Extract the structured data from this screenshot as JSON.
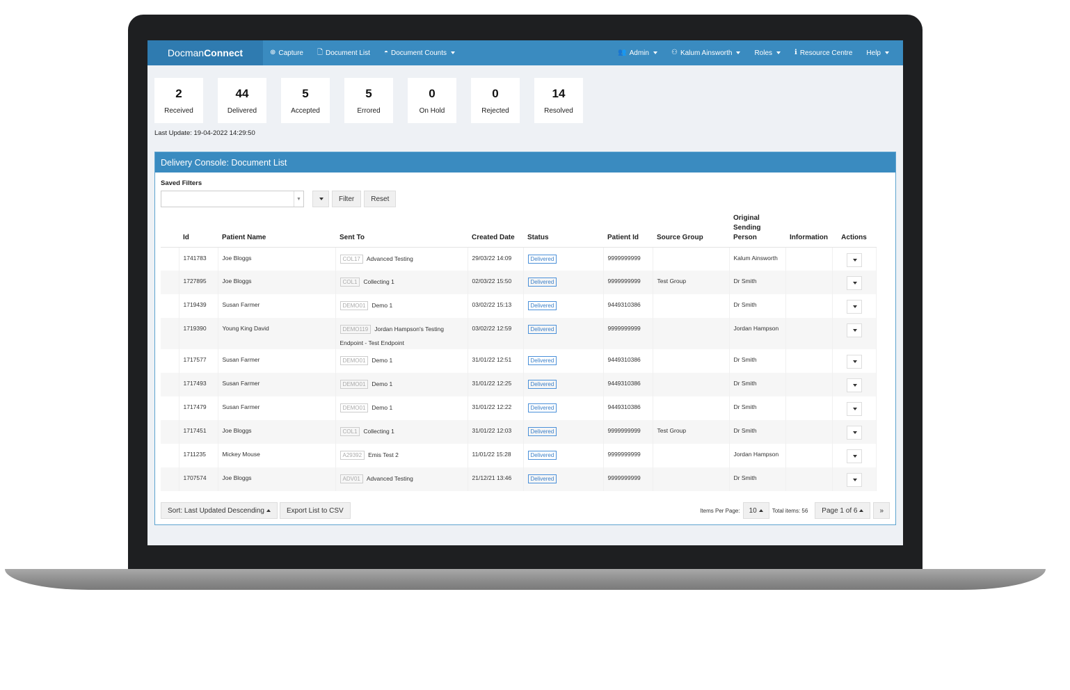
{
  "nav": {
    "brand_prefix": "Docman",
    "brand_suffix": "Connect",
    "capture": "Capture",
    "document_list": "Document List",
    "document_counts": "Document Counts",
    "admin": "Admin",
    "user": "Kalum Ainsworth",
    "roles": "Roles",
    "resource_centre": "Resource Centre",
    "help": "Help"
  },
  "stats": [
    {
      "value": "2",
      "label": "Received"
    },
    {
      "value": "44",
      "label": "Delivered"
    },
    {
      "value": "5",
      "label": "Accepted"
    },
    {
      "value": "5",
      "label": "Errored"
    },
    {
      "value": "0",
      "label": "On Hold"
    },
    {
      "value": "0",
      "label": "Rejected"
    },
    {
      "value": "14",
      "label": "Resolved"
    }
  ],
  "last_update": "Last Update: 19-04-2022 14:29:50",
  "panel": {
    "title": "Delivery Console: Document List",
    "saved_filters_label": "Saved Filters",
    "filter_button": "Filter",
    "reset_button": "Reset"
  },
  "table": {
    "headers": {
      "id": "Id",
      "patient_name": "Patient Name",
      "sent_to": "Sent To",
      "created_date": "Created Date",
      "status": "Status",
      "patient_id": "Patient Id",
      "source_group": "Source Group",
      "sending_person": "Original Sending Person",
      "information": "Information",
      "actions": "Actions"
    },
    "rows": [
      {
        "id": "1741783",
        "name": "Joe Bloggs",
        "code": "COL17",
        "dest": "Advanced Testing",
        "dest2": "",
        "date": "29/03/22 14:09",
        "status": "Delivered",
        "pid": "9999999999",
        "group": "",
        "person": "Kalum Ainsworth"
      },
      {
        "id": "1727895",
        "name": "Joe Bloggs",
        "code": "COL1",
        "dest": "Collecting 1",
        "dest2": "",
        "date": "02/03/22 15:50",
        "status": "Delivered",
        "pid": "9999999999",
        "group": "Test Group",
        "person": "Dr Smith"
      },
      {
        "id": "1719439",
        "name": "Susan Farmer",
        "code": "DEMO01",
        "dest": "Demo 1",
        "dest2": "",
        "date": "03/02/22 15:13",
        "status": "Delivered",
        "pid": "9449310386",
        "group": "",
        "person": "Dr Smith"
      },
      {
        "id": "1719390",
        "name": "Young King David",
        "code": "DEMO119",
        "dest": "Jordan Hampson's Testing",
        "dest2": "Endpoint - Test Endpoint",
        "date": "03/02/22 12:59",
        "status": "Delivered",
        "pid": "9999999999",
        "group": "",
        "person": "Jordan Hampson"
      },
      {
        "id": "1717577",
        "name": "Susan Farmer",
        "code": "DEMO01",
        "dest": "Demo 1",
        "dest2": "",
        "date": "31/01/22 12:51",
        "status": "Delivered",
        "pid": "9449310386",
        "group": "",
        "person": "Dr Smith"
      },
      {
        "id": "1717493",
        "name": "Susan Farmer",
        "code": "DEMO01",
        "dest": "Demo 1",
        "dest2": "",
        "date": "31/01/22 12:25",
        "status": "Delivered",
        "pid": "9449310386",
        "group": "",
        "person": "Dr Smith"
      },
      {
        "id": "1717479",
        "name": "Susan Farmer",
        "code": "DEMO01",
        "dest": "Demo 1",
        "dest2": "",
        "date": "31/01/22 12:22",
        "status": "Delivered",
        "pid": "9449310386",
        "group": "",
        "person": "Dr Smith"
      },
      {
        "id": "1717451",
        "name": "Joe Bloggs",
        "code": "COL1",
        "dest": "Collecting 1",
        "dest2": "",
        "date": "31/01/22 12:03",
        "status": "Delivered",
        "pid": "9999999999",
        "group": "Test Group",
        "person": "Dr Smith"
      },
      {
        "id": "1711235",
        "name": "Mickey Mouse",
        "code": "A29392",
        "dest": "Emis Test 2",
        "dest2": "",
        "date": "11/01/22 15:28",
        "status": "Delivered",
        "pid": "9999999999",
        "group": "",
        "person": "Jordan Hampson"
      },
      {
        "id": "1707574",
        "name": "Joe Bloggs",
        "code": "ADV01",
        "dest": "Advanced Testing",
        "dest2": "",
        "date": "21/12/21 13:46",
        "status": "Delivered",
        "pid": "9999999999",
        "group": "",
        "person": "Dr Smith"
      }
    ]
  },
  "footer": {
    "sort_button": "Sort: Last Updated  Descending",
    "export_button": "Export List to CSV",
    "items_per_page_label": "Items Per Page:",
    "items_per_page_value": "10",
    "total_items": "Total items: 56",
    "page_label": "Page 1 of 6",
    "next_label": "»"
  },
  "colors": {
    "navbar": "#3a8bc0",
    "brand_bg": "#2f7bb0",
    "status_blue": "#3a7fc8"
  }
}
